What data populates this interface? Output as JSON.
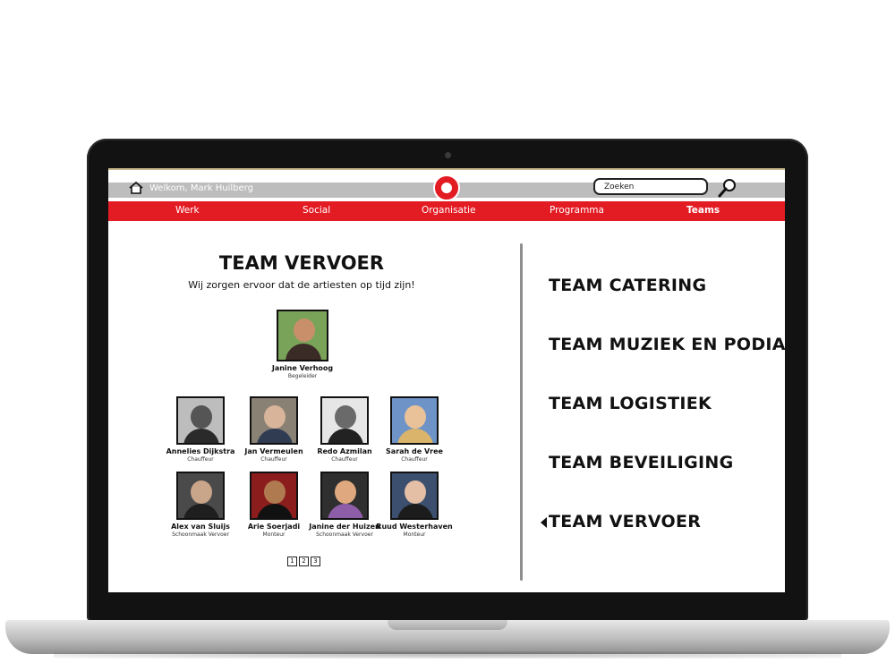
{
  "header": {
    "welcome_text": "Welkom, Mark Huilberg",
    "search_placeholder": "Zoeken",
    "brand_color": "#e31b23"
  },
  "nav": {
    "items": [
      {
        "label": "Werk",
        "active": false
      },
      {
        "label": "Social",
        "active": false
      },
      {
        "label": "Organisatie",
        "active": false
      },
      {
        "label": "Programma",
        "active": false
      },
      {
        "label": "Teams",
        "active": true
      }
    ]
  },
  "team": {
    "title": "TEAM VERVOER",
    "subtitle": "Wij zorgen ervoor dat de artiesten op tijd zijn!",
    "leader": {
      "name": "Janine Verhoog",
      "role": "Begeleider"
    },
    "members": [
      {
        "name": "Annelies Dijkstra",
        "role": "Chauffeur"
      },
      {
        "name": "Jan Vermeulen",
        "role": "Chauffeur"
      },
      {
        "name": "Redo Azmilan",
        "role": "Chauffeur"
      },
      {
        "name": "Sarah de Vree",
        "role": "Chauffeur"
      },
      {
        "name": "Alex van Sluijs",
        "role": "Schoonmaak Vervoer"
      },
      {
        "name": "Arie Soerjadi",
        "role": "Monteur"
      },
      {
        "name": "Janine der Huizen",
        "role": "Schoonmaak Vervoer"
      },
      {
        "name": "Ruud Westerhaven",
        "role": "Monteur"
      }
    ]
  },
  "pagination": {
    "pages": [
      "1",
      "2",
      "3"
    ]
  },
  "teams_list": {
    "items": [
      {
        "label": "TEAM CATERING",
        "selected": false
      },
      {
        "label": "TEAM MUZIEK EN PODIA",
        "selected": false
      },
      {
        "label": "TEAM LOGISTIEK",
        "selected": false
      },
      {
        "label": "TEAM BEVEILIGING",
        "selected": false
      },
      {
        "label": "TEAM VERVOER",
        "selected": true
      }
    ]
  },
  "icons": {
    "home": "home-icon",
    "search": "search-icon",
    "logo": "logo-icon",
    "selected_marker": "arrow-left-icon"
  }
}
